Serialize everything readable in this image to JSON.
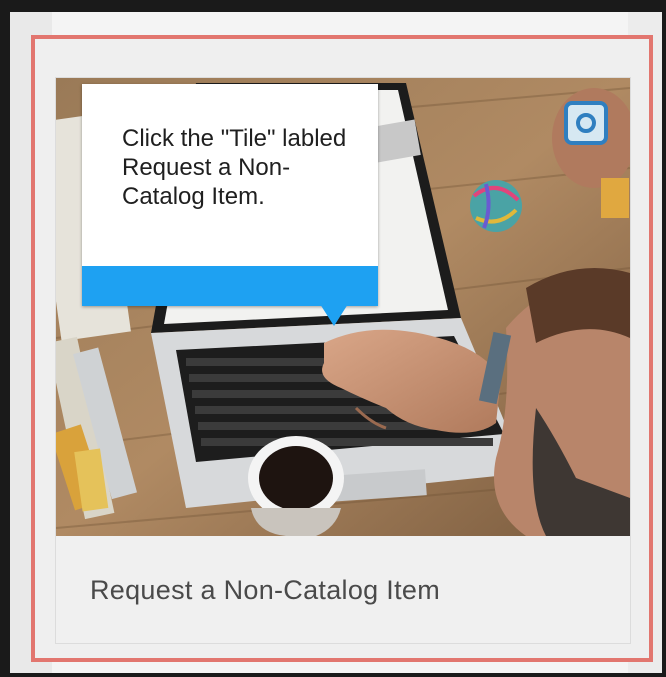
{
  "tile": {
    "title": "Request a Non-Catalog Item",
    "image_alt": "Person typing on a laptop with a coffee cup on a wooden desk"
  },
  "callout": {
    "text": "Click the \"Tile\" labled Request a Non-Catalog Item."
  },
  "colors": {
    "highlight_border": "#e2766f",
    "callout_bar": "#1ea1f2",
    "title_text": "#4a4a4a"
  }
}
